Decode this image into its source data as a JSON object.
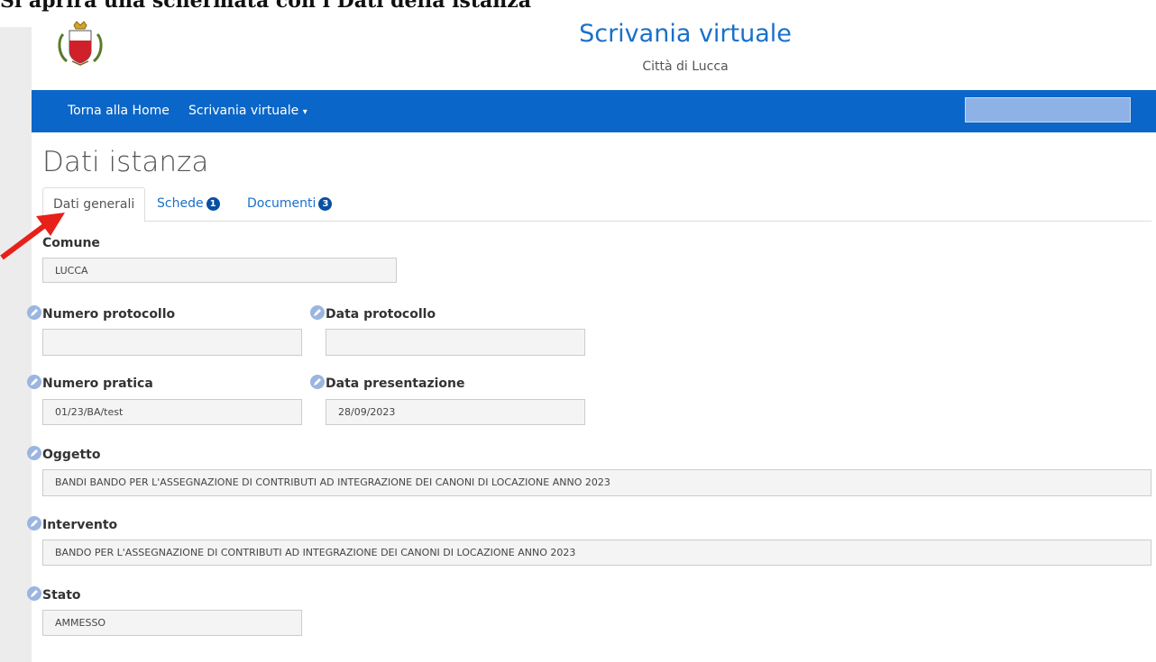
{
  "caption": "Si apriră una schermata con i Dati della istanza",
  "header": {
    "title": "Scrivania virtuale",
    "subtitle": "Città di Lucca"
  },
  "nav": {
    "home": "Torna alla Home",
    "menu": "Scrivania virtuale",
    "menu_caret": "▾"
  },
  "page": {
    "heading": "Dati istanza"
  },
  "tabs": [
    {
      "label": "Dati generali"
    },
    {
      "label": "Schede",
      "badge": "1"
    },
    {
      "label": "Documenti",
      "badge": "3"
    }
  ],
  "fields": {
    "comune": {
      "label": "Comune",
      "value": "LUCCA"
    },
    "numero_protocollo": {
      "label": "Numero protocollo",
      "value": ""
    },
    "data_protocollo": {
      "label": "Data protocollo",
      "value": ""
    },
    "numero_pratica": {
      "label": "Numero pratica",
      "value": "01/23/BA/test"
    },
    "data_presentazione": {
      "label": "Data presentazione",
      "value": "28/09/2023"
    },
    "oggetto": {
      "label": "Oggetto",
      "value": "BANDI BANDO PER L'ASSEGNAZIONE DI CONTRIBUTI AD INTEGRAZIONE DEI CANONI DI LOCAZIONE ANNO 2023"
    },
    "intervento": {
      "label": "Intervento",
      "value": "BANDO PER L'ASSEGNAZIONE DI CONTRIBUTI AD INTEGRAZIONE DEI CANONI DI LOCAZIONE ANNO 2023"
    },
    "stato": {
      "label": "Stato",
      "value": "AMMESSO"
    }
  },
  "colors": {
    "brand": "#0a66c8",
    "title": "#1a70c9",
    "badge": "#0a4fa0",
    "arrow": "#e8201a"
  },
  "icons": {
    "logo": "city-coat-of-arms-icon",
    "edit": "pencil-icon",
    "pointer": "red-arrow-icon"
  }
}
